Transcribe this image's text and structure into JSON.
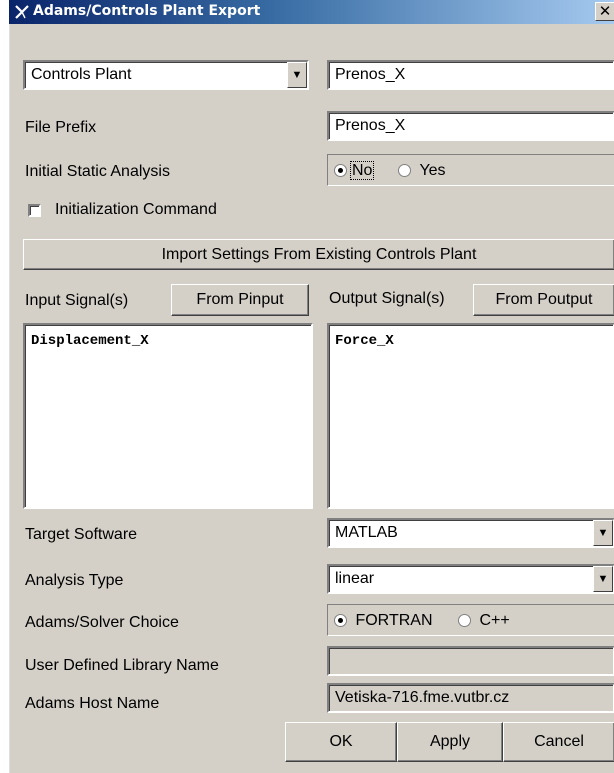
{
  "window": {
    "title": "Adams/Controls Plant Export",
    "close_label": "✕"
  },
  "plant_select": {
    "value": "Controls Plant"
  },
  "plant_name": {
    "value": "Prenos_X"
  },
  "file_prefix": {
    "label": "File Prefix",
    "value": "Prenos_X"
  },
  "initial_static": {
    "label": "Initial Static Analysis",
    "options": [
      "No",
      "Yes"
    ],
    "selected": "No"
  },
  "init_command": {
    "label": "Initialization Command",
    "checked": false
  },
  "import_button": {
    "label": "Import Settings From Existing Controls Plant"
  },
  "input_signals": {
    "label": "Input Signal(s)",
    "button": "From Pinput",
    "items": [
      "Displacement_X"
    ]
  },
  "output_signals": {
    "label": "Output Signal(s)",
    "button": "From Poutput",
    "items": [
      "Force_X"
    ]
  },
  "target_software": {
    "label": "Target Software",
    "value": "MATLAB"
  },
  "analysis_type": {
    "label": "Analysis Type",
    "value": "linear"
  },
  "solver_choice": {
    "label": "Adams/Solver Choice",
    "options": [
      "FORTRAN",
      "C++"
    ],
    "selected": "FORTRAN"
  },
  "user_library": {
    "label": "User Defined Library Name",
    "value": ""
  },
  "host_name": {
    "label": "Adams Host Name",
    "value": "Vetiska-716.fme.vutbr.cz"
  },
  "footer": {
    "ok": "OK",
    "apply": "Apply",
    "cancel": "Cancel"
  },
  "icons": {
    "app": "adams-logo-icon",
    "dropdown": "chevron-down-icon"
  },
  "colors": {
    "titlebar_start": "#0a246a",
    "titlebar_end": "#a6caf0",
    "face": "#d4d0c8"
  }
}
